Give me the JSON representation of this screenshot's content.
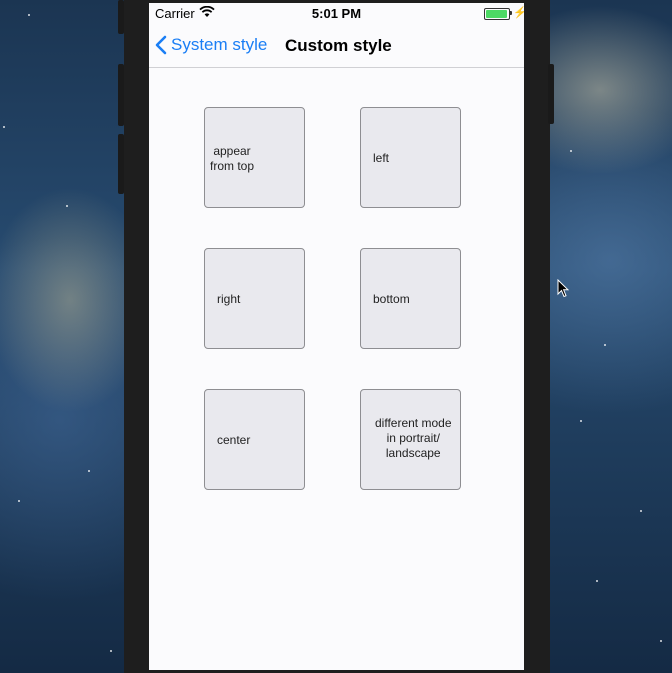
{
  "status_bar": {
    "carrier": "Carrier",
    "time": "5:01 PM",
    "battery_level": 1.0,
    "battery_color": "#4cd964"
  },
  "nav_bar": {
    "back_label": "System style",
    "title": "Custom style",
    "accent_color": "#1a7ef5"
  },
  "buttons": [
    {
      "label": "appear\nfrom top"
    },
    {
      "label": "left"
    },
    {
      "label": "right"
    },
    {
      "label": "bottom"
    },
    {
      "label": "center"
    },
    {
      "label": "different mode\nin portrait/\nlandscape"
    }
  ],
  "icons": {
    "wifi": "wifi-icon",
    "back": "chevron-left-icon",
    "charging": "bolt-icon",
    "battery": "battery-icon",
    "cursor": "mouse-cursor-icon"
  }
}
